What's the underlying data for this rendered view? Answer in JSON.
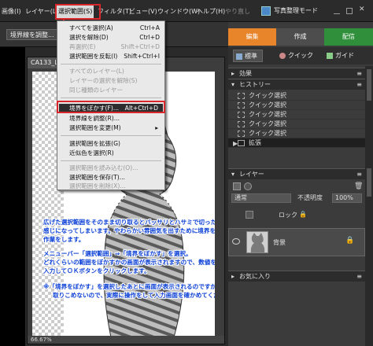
{
  "menubar": {
    "items": [
      {
        "label": "画像(I)"
      },
      {
        "label": "レイヤー(L)"
      },
      {
        "label": "選択範囲(S)"
      },
      {
        "label": "フィルタ(T)"
      },
      {
        "label": "ビュー(V)"
      },
      {
        "label": "ウィンドウ(W)"
      },
      {
        "label": "ヘルプ(H)"
      },
      {
        "label": "やり直し"
      }
    ],
    "mode_button": "写真整理モード"
  },
  "options_bar": {
    "button": "境界線を調整..."
  },
  "document": {
    "tab_title": "CA133_L",
    "zoom": "66.67%"
  },
  "select_menu": {
    "items": [
      {
        "label": "すべてを選択(A)",
        "shortcut": "Ctrl+A"
      },
      {
        "label": "選択を解除(D)",
        "shortcut": "Ctrl+D"
      },
      {
        "label": "再選択(E)",
        "shortcut": "Shift+Ctrl+D"
      },
      {
        "label": "選択範囲を反転(I)",
        "shortcut": "Shift+Ctrl+I"
      },
      {
        "label": "すべてのレイヤー(L)",
        "shortcut": ""
      },
      {
        "label": "レイヤーの選択を解除(S)",
        "shortcut": ""
      },
      {
        "label": "同じ種類のレイヤー",
        "shortcut": ""
      },
      {
        "label": "境界をぼかす(F)...",
        "shortcut": "Alt+Ctrl+D"
      },
      {
        "label": "境界線を調整(R)...",
        "shortcut": ""
      },
      {
        "label": "選択範囲を変更(M)",
        "shortcut": ""
      },
      {
        "label": "選択範囲を拡張(G)",
        "shortcut": ""
      },
      {
        "label": "近似色を選択(R)",
        "shortcut": ""
      },
      {
        "label": "選択範囲を読み込む(O)...",
        "shortcut": ""
      },
      {
        "label": "選択範囲を保存(T)...",
        "shortcut": ""
      },
      {
        "label": "選択範囲を削除(X)...",
        "shortcut": ""
      }
    ]
  },
  "annotation": {
    "para1": [
      "広げた選択範囲をそのまま切り取るとバッサリとハサミで切ったような",
      "感じになってしまいます。やわらかい雰囲気を出すために境界をぼかす",
      "作業をします。"
    ],
    "para2": [
      "メニューバー「選択範囲」⇒「境界をぼかす」を選択。",
      "どれくらいの範囲をぼかすかの画面が表示されますので、数値を",
      "入力してＯＫボタンをクリックします。"
    ],
    "para3": [
      "※「境界をぼかす」を選択したあとに画面が表示されるのですが、画面が",
      "取りこめないので、実際に操作をして入力画面を確かめてください。"
    ]
  },
  "panel": {
    "tabs": [
      {
        "label": "編集",
        "color": "#e8842a"
      },
      {
        "label": "作成",
        "color": "#4d4d4d"
      },
      {
        "label": "配信",
        "color": "#2f8f3a"
      }
    ],
    "subtabs": [
      "標準",
      "クイック",
      "ガイド"
    ],
    "effects_title": "効果",
    "history_title": "ヒストリー",
    "history": [
      "クイック選択",
      "クイック選択",
      "クイック選択",
      "クイック選択",
      "クイック選択",
      "拡張"
    ],
    "layers_title": "レイヤー",
    "blend_mode": "通常",
    "opacity_label": "不透明度",
    "opacity": "100%",
    "lock_label": "ロック",
    "layer_name": "背景",
    "favorites_title": "お気に入り"
  },
  "colors": {
    "accent_red": "#d9262a",
    "annotation_blue": "#0a3fd6",
    "edit_tab": "#e8842a",
    "publish_tab": "#2f8f3a"
  }
}
